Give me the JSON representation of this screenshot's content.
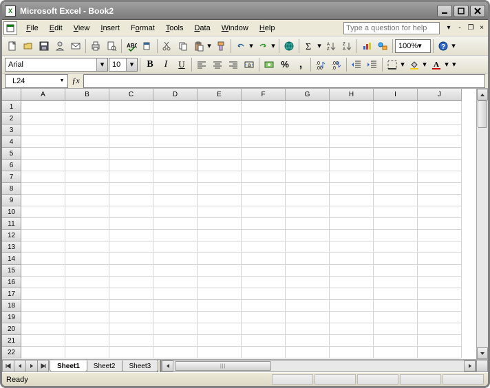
{
  "titlebar": {
    "title": "Microsoft Excel - Book2"
  },
  "menu": {
    "items": [
      {
        "u": "F",
        "rest": "ile"
      },
      {
        "u": "E",
        "rest": "dit"
      },
      {
        "u": "V",
        "rest": "iew"
      },
      {
        "u": "I",
        "rest": "nsert"
      },
      {
        "u": "F",
        "rest2": "ormat",
        "pre": "",
        "full": "Format",
        "upos": 1
      },
      {
        "u": "T",
        "rest": "ools"
      },
      {
        "u": "D",
        "rest": "ata"
      },
      {
        "u": "W",
        "rest": "indow"
      },
      {
        "u": "H",
        "rest": "elp"
      }
    ],
    "help_placeholder": "Type a question for help"
  },
  "format": {
    "font": "Arial",
    "size": "10",
    "zoom": "100%"
  },
  "namebox": {
    "ref": "L24"
  },
  "columns": [
    "A",
    "B",
    "C",
    "D",
    "E",
    "F",
    "G",
    "H",
    "I",
    "J"
  ],
  "rows": [
    "1",
    "2",
    "3",
    "4",
    "5",
    "6",
    "7",
    "8",
    "9",
    "10",
    "11",
    "12",
    "13",
    "14",
    "15",
    "16",
    "17",
    "18",
    "19",
    "20",
    "21",
    "22"
  ],
  "sheets": {
    "active": "Sheet1",
    "others": [
      "Sheet2",
      "Sheet3"
    ]
  },
  "status": {
    "text": "Ready"
  }
}
